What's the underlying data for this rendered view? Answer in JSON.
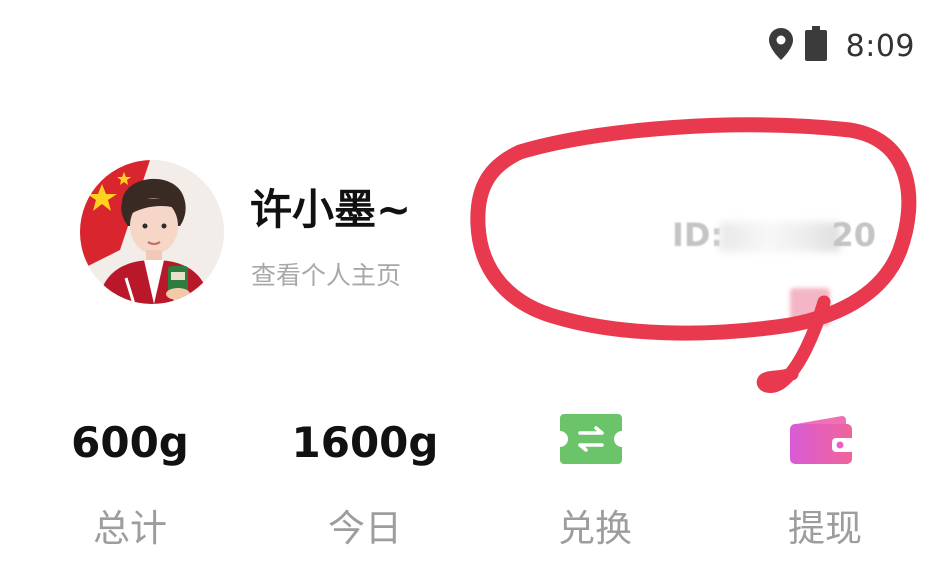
{
  "status_bar": {
    "time": "8:09",
    "icons": [
      "location-pin-icon",
      "battery-icon"
    ]
  },
  "profile": {
    "username": "许小墨~",
    "view_profile_link": "查看个人主页",
    "id_prefix": "ID:",
    "id_suffix": "20"
  },
  "stats": [
    {
      "value": "600g",
      "label": "总计"
    },
    {
      "value": "1600g",
      "label": "今日"
    }
  ],
  "actions": [
    {
      "label": "兑换",
      "icon": "exchange-ticket-icon",
      "color": "#6cc46a"
    },
    {
      "label": "提现",
      "icon": "wallet-icon",
      "color": "#e860c8"
    }
  ],
  "colors": {
    "scribble": "#e8394f",
    "username": "#111111",
    "secondary_text": "#a8a8a8",
    "stat_label": "#9d9d9d"
  }
}
